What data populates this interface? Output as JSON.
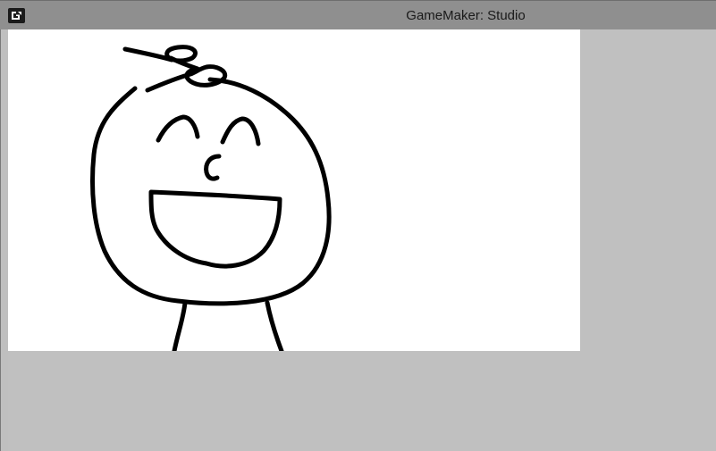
{
  "window": {
    "title": "GameMaker: Studio",
    "app_icon": "gamemaker-logo-icon"
  },
  "game": {
    "drawing": "smiling-stick-figure-face"
  },
  "colors": {
    "titlebar": "#8f8f8f",
    "client_background": "#c0c0c0",
    "canvas_background": "#ffffff",
    "ink": "#000000"
  }
}
